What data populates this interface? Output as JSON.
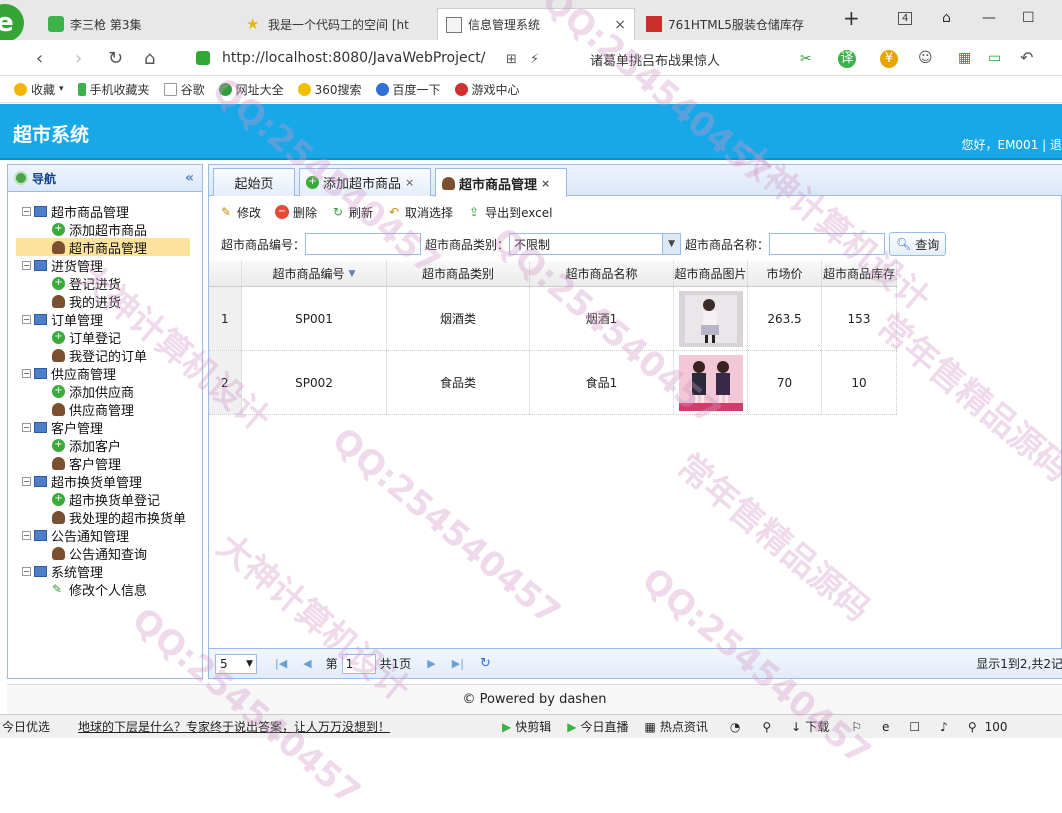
{
  "browser_tabs": [
    {
      "title": "李三枪 第3集",
      "icon": "video-icon"
    },
    {
      "title": "我是一个代码工的空间 [ht",
      "icon": "star-icon"
    },
    {
      "title": "信息管理系统",
      "icon": "chart-icon",
      "active": true
    },
    {
      "title": "761HTML5服装仓储库存",
      "icon": "page-icon"
    }
  ],
  "window": {
    "tab_count": "4"
  },
  "address": {
    "url": "http://localhost:8080/JavaWebProject/",
    "search": "诸葛单挑吕布战果惊人"
  },
  "bookmarks": [
    "收藏",
    "手机收藏夹",
    "谷歌",
    "网址大全",
    "360搜索",
    "百度一下",
    "游戏中心"
  ],
  "app": {
    "title": "超市系统",
    "user_info": "您好，EM001 | 退"
  },
  "sidebar": {
    "title": "导航",
    "groups": [
      {
        "label": "超市商品管理",
        "items": [
          "添加超市商品",
          "超市商品管理"
        ]
      },
      {
        "label": "进货管理",
        "items": [
          "登记进货",
          "我的进货"
        ]
      },
      {
        "label": "订单管理",
        "items": [
          "订单登记",
          "我登记的订单"
        ]
      },
      {
        "label": "供应商管理",
        "items": [
          "添加供应商",
          "供应商管理"
        ]
      },
      {
        "label": "客户管理",
        "items": [
          "添加客户",
          "客户管理"
        ]
      },
      {
        "label": "超市换货单管理",
        "items": [
          "超市换货单登记",
          "我处理的超市换货单"
        ]
      },
      {
        "label": "公告通知管理",
        "items": [
          "公告通知查询"
        ]
      },
      {
        "label": "系统管理",
        "items": [
          "修改个人信息"
        ]
      }
    ]
  },
  "tabs": [
    "起始页",
    "添加超市商品",
    "超市商品管理"
  ],
  "toolbar": {
    "edit": "修改",
    "delete": "删除",
    "refresh": "刷新",
    "unselect": "取消选择",
    "export": "导出到excel"
  },
  "filters": {
    "code_label": "超市商品编号：",
    "category_label": "超市商品类别：",
    "category_value": "不限制",
    "name_label": "超市商品名称：",
    "query": "查询"
  },
  "grid": {
    "columns": [
      "超市商品编号",
      "超市商品类别",
      "超市商品名称",
      "超市商品图片",
      "市场价",
      "超市商品库存"
    ],
    "rows": [
      {
        "num": "1",
        "code": "SP001",
        "category": "烟酒类",
        "name": "烟酒1",
        "price": "263.5",
        "stock": "153"
      },
      {
        "num": "2",
        "code": "SP002",
        "category": "食品类",
        "name": "食品1",
        "price": "70",
        "stock": "10"
      }
    ]
  },
  "pager": {
    "page_size": "5",
    "page_prefix": "第",
    "page": "1",
    "page_suffix": "共1页",
    "info": "显示1到2,共2记"
  },
  "footer": "© Powered by dashen",
  "status": {
    "left": "今日优选",
    "news": "地球的下层是什么？专家终于说出答案，让人万万没想到！",
    "items": [
      "快剪辑",
      "今日直播",
      "热点资讯",
      "下载"
    ],
    "zoom": "100"
  },
  "watermarks": [
    "QQ:254540457",
    "大神计算机设计",
    "常年售精品源码"
  ]
}
